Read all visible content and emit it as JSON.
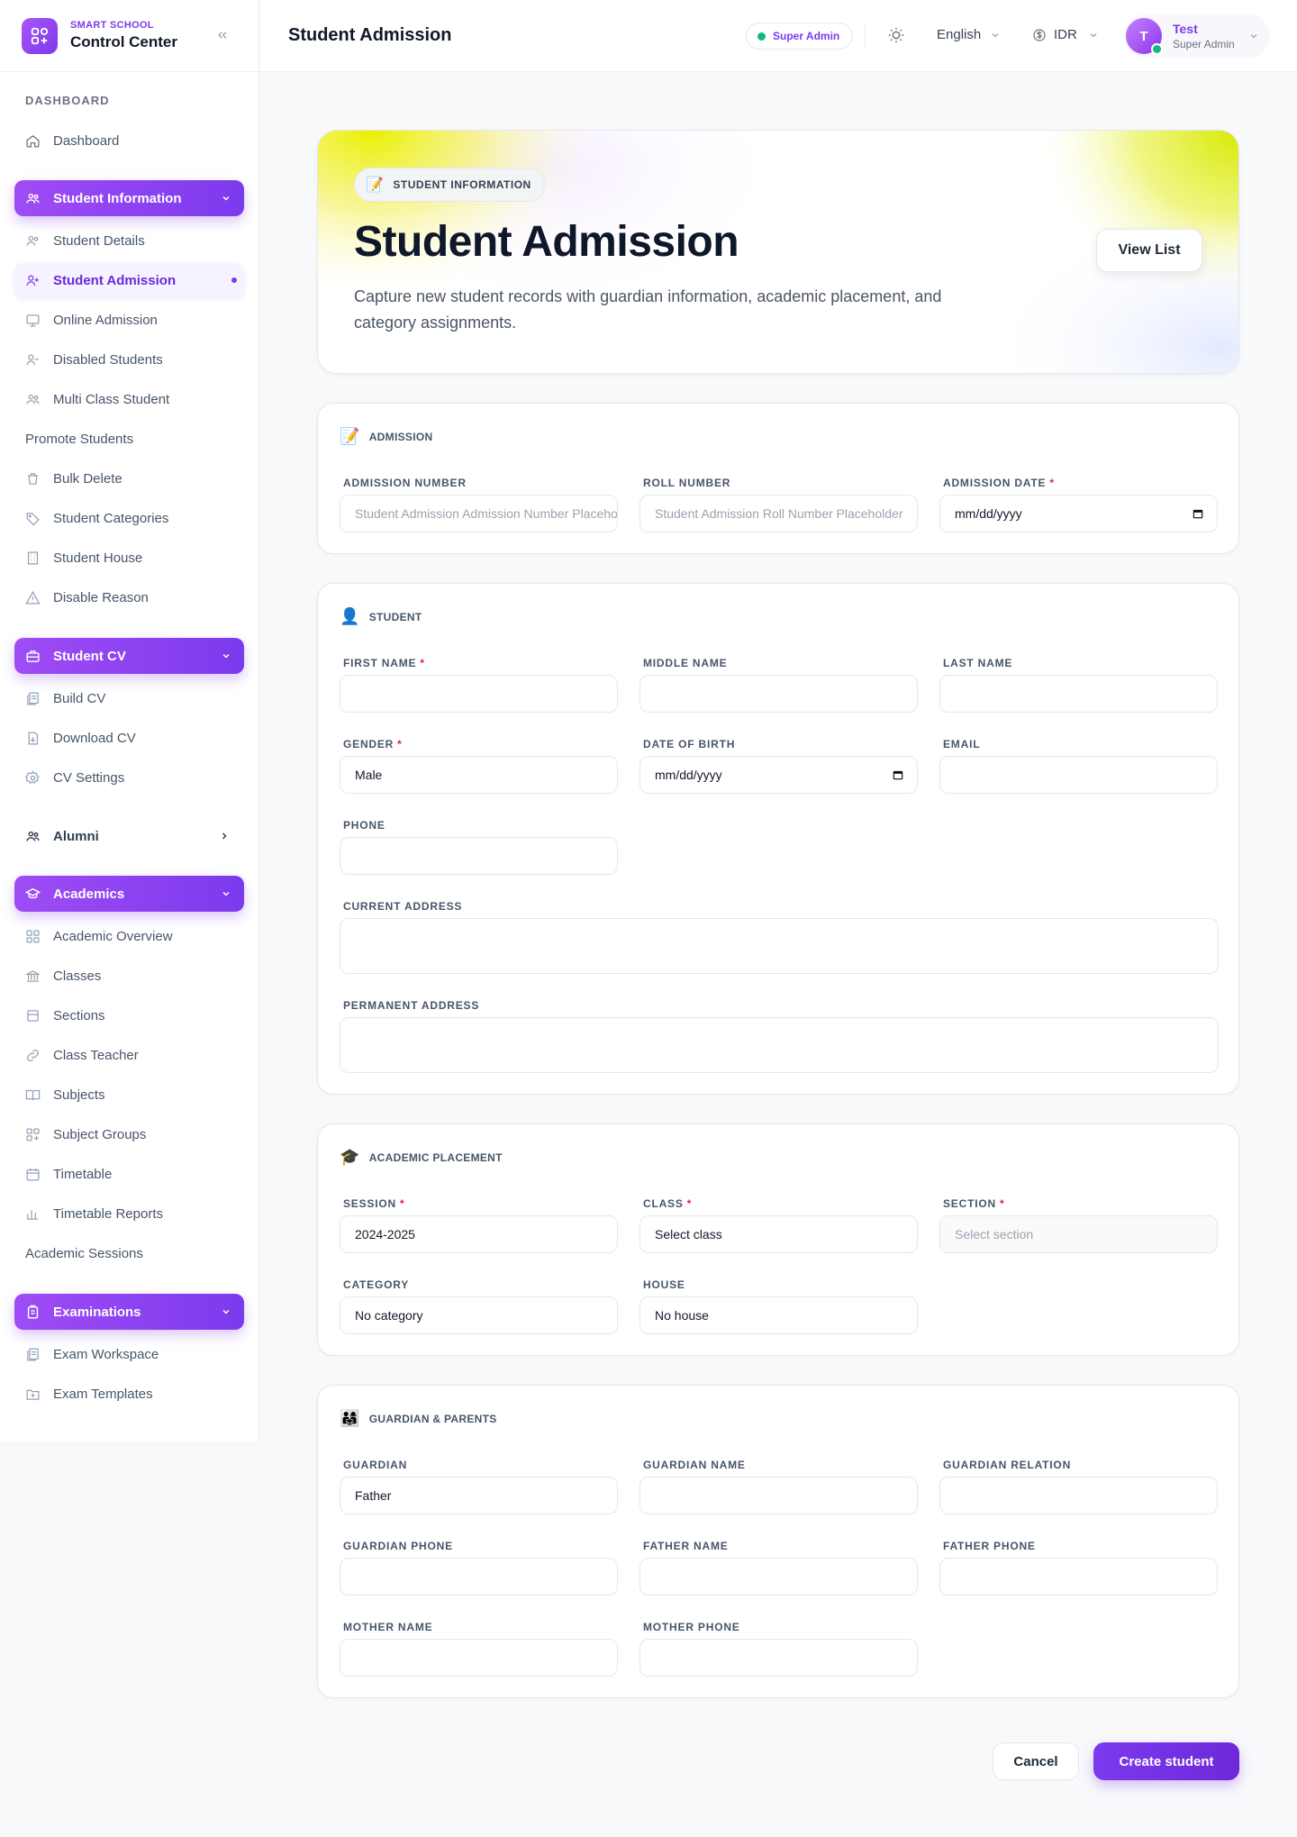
{
  "brand": {
    "subtitle": "SMART SCHOOL",
    "title": "Control Center"
  },
  "sidebar": {
    "section_label": "DASHBOARD",
    "dashboard": "Dashboard",
    "student_information": {
      "label": "Student Information",
      "items": [
        "Student Details",
        "Student Admission",
        "Online Admission",
        "Disabled Students",
        "Multi Class Student",
        "Promote Students",
        "Bulk Delete",
        "Student Categories",
        "Student House",
        "Disable Reason"
      ]
    },
    "student_cv": {
      "label": "Student CV",
      "items": [
        "Build CV",
        "Download CV",
        "CV Settings"
      ]
    },
    "alumni": "Alumni",
    "academics": {
      "label": "Academics",
      "items": [
        "Academic Overview",
        "Classes",
        "Sections",
        "Class Teacher",
        "Subjects",
        "Subject Groups",
        "Timetable",
        "Timetable Reports",
        "Academic Sessions"
      ]
    },
    "examinations": {
      "label": "Examinations",
      "items": [
        "Exam Workspace",
        "Exam Templates"
      ]
    }
  },
  "header": {
    "title": "Student Admission",
    "role_badge": "Super Admin",
    "language": "English",
    "currency": "IDR",
    "user": {
      "initial": "T",
      "name": "Test",
      "role": "Super Admin"
    }
  },
  "hero": {
    "badge": "STUDENT INFORMATION",
    "badge_icon": "📝",
    "title": "Student Admission",
    "description": "Capture new student records with guardian information, academic placement, and category assignments.",
    "view_list": "View List"
  },
  "admission": {
    "heading": "ADMISSION",
    "icon": "📝",
    "admission_number": {
      "label": "ADMISSION NUMBER",
      "placeholder": "Student Admission Admission Number Placeholder"
    },
    "roll_number": {
      "label": "ROLL NUMBER",
      "placeholder": "Student Admission Roll Number Placeholder"
    },
    "admission_date": {
      "label": "ADMISSION DATE",
      "value": "mm/dd/yyyy"
    }
  },
  "student": {
    "heading": "STUDENT",
    "icon": "👤",
    "first_name": "FIRST NAME",
    "middle_name": "MIDDLE NAME",
    "last_name": "LAST NAME",
    "gender": {
      "label": "GENDER",
      "value": "Male"
    },
    "dob": {
      "label": "DATE OF BIRTH",
      "value": "mm/dd/yyyy"
    },
    "email": "EMAIL",
    "phone": "PHONE",
    "current_address": "CURRENT ADDRESS",
    "permanent_address": "PERMANENT ADDRESS"
  },
  "academic": {
    "heading": "ACADEMIC PLACEMENT",
    "icon": "🎓",
    "session": {
      "label": "SESSION",
      "value": "2024-2025"
    },
    "class": {
      "label": "CLASS",
      "value": "Select class"
    },
    "section": {
      "label": "SECTION",
      "value": "Select section"
    },
    "category": {
      "label": "CATEGORY",
      "value": "No category"
    },
    "house": {
      "label": "HOUSE",
      "value": "No house"
    }
  },
  "guardian": {
    "heading": "GUARDIAN & PARENTS",
    "icon": "👨‍👩‍👧",
    "guardian": {
      "label": "GUARDIAN",
      "value": "Father"
    },
    "guardian_name": "GUARDIAN NAME",
    "guardian_relation": "GUARDIAN RELATION",
    "guardian_phone": "GUARDIAN PHONE",
    "father_name": "FATHER NAME",
    "father_phone": "FATHER PHONE",
    "mother_name": "MOTHER NAME",
    "mother_phone": "MOTHER PHONE"
  },
  "actions": {
    "cancel": "Cancel",
    "create": "Create student"
  }
}
